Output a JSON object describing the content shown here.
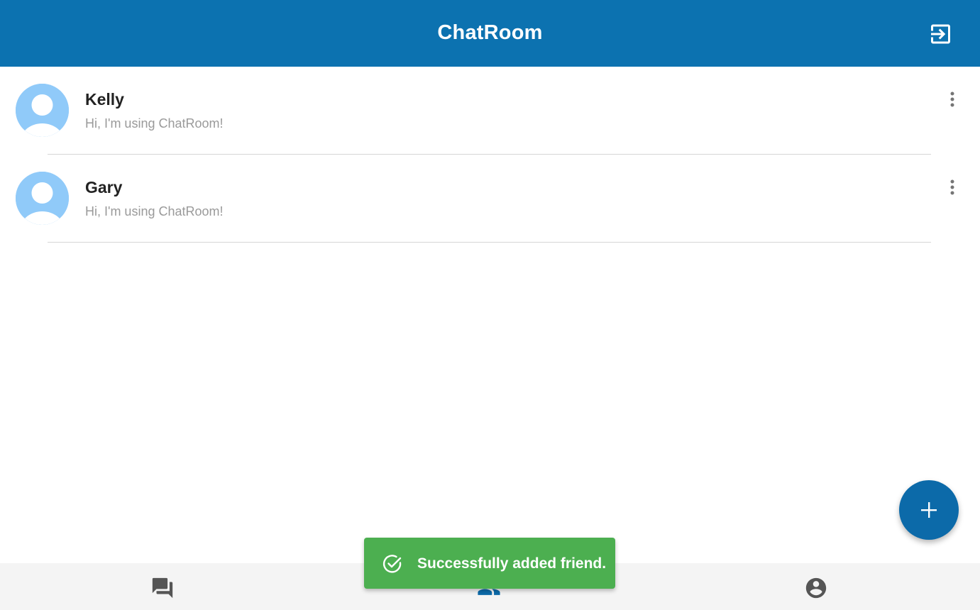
{
  "app_bar": {
    "title": "ChatRoom",
    "logout_icon": "exit-to-app-icon"
  },
  "friends": [
    {
      "name": "Kelly",
      "status": "Hi, I'm using ChatRoom!",
      "avatar_icon": "default-avatar-icon",
      "menu_icon": "more-vert-icon"
    },
    {
      "name": "Gary",
      "status": "Hi, I'm using ChatRoom!",
      "avatar_icon": "default-avatar-icon",
      "menu_icon": "more-vert-icon"
    }
  ],
  "fab": {
    "icon": "plus-icon"
  },
  "bottom_nav": {
    "items": [
      {
        "icon": "forum-icon"
      },
      {
        "icon": "people-icon",
        "active": true
      },
      {
        "icon": "account-circle-icon"
      }
    ]
  },
  "snackbar": {
    "message": "Successfully added friend.",
    "icon": "check-circle-icon"
  },
  "colors": {
    "primary": "#0c72b0",
    "avatar_bg": "#90caf9",
    "success": "#4caf50",
    "nav_bg": "#f4f4f4",
    "icon_gray": "#555555"
  }
}
